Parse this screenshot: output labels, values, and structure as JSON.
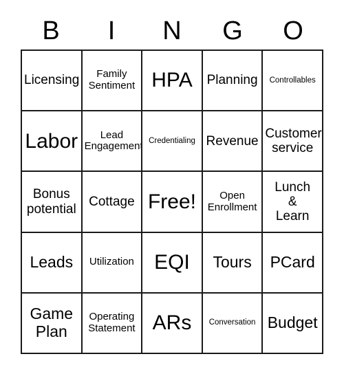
{
  "card": {
    "title": "BINGO",
    "header_letters": [
      "B",
      "I",
      "N",
      "G",
      "O"
    ],
    "grid_size": "5x5",
    "free_space": "Free!",
    "colors": {
      "border": "#1a1a1a",
      "background": "#ffffff",
      "text": "#000000"
    },
    "rows": [
      [
        {
          "label": "Licensing",
          "size": "md"
        },
        {
          "label": "Family\nSentiment",
          "size": "sm"
        },
        {
          "label": "HPA",
          "size": "xl"
        },
        {
          "label": "Planning",
          "size": "md"
        },
        {
          "label": "Controllables",
          "size": "xs"
        }
      ],
      [
        {
          "label": "Labor",
          "size": "xl"
        },
        {
          "label": "Lead\nEngagement",
          "size": "sm"
        },
        {
          "label": "Credentialing",
          "size": "xs"
        },
        {
          "label": "Revenue",
          "size": "md"
        },
        {
          "label": "Customer\nservice",
          "size": "md"
        }
      ],
      [
        {
          "label": "Bonus\npotential",
          "size": "md"
        },
        {
          "label": "Cottage",
          "size": "md"
        },
        {
          "label": "Free!",
          "size": "xl"
        },
        {
          "label": "Open\nEnrollment",
          "size": "sm"
        },
        {
          "label": "Lunch\n&\nLearn",
          "size": "md"
        }
      ],
      [
        {
          "label": "Leads",
          "size": "lg"
        },
        {
          "label": "Utilization",
          "size": "sm"
        },
        {
          "label": "EQI",
          "size": "xl"
        },
        {
          "label": "Tours",
          "size": "lg"
        },
        {
          "label": "PCard",
          "size": "lg"
        }
      ],
      [
        {
          "label": "Game\nPlan",
          "size": "lg"
        },
        {
          "label": "Operating\nStatement",
          "size": "sm"
        },
        {
          "label": "ARs",
          "size": "xl"
        },
        {
          "label": "Conversation",
          "size": "xs"
        },
        {
          "label": "Budget",
          "size": "lg"
        }
      ]
    ]
  }
}
